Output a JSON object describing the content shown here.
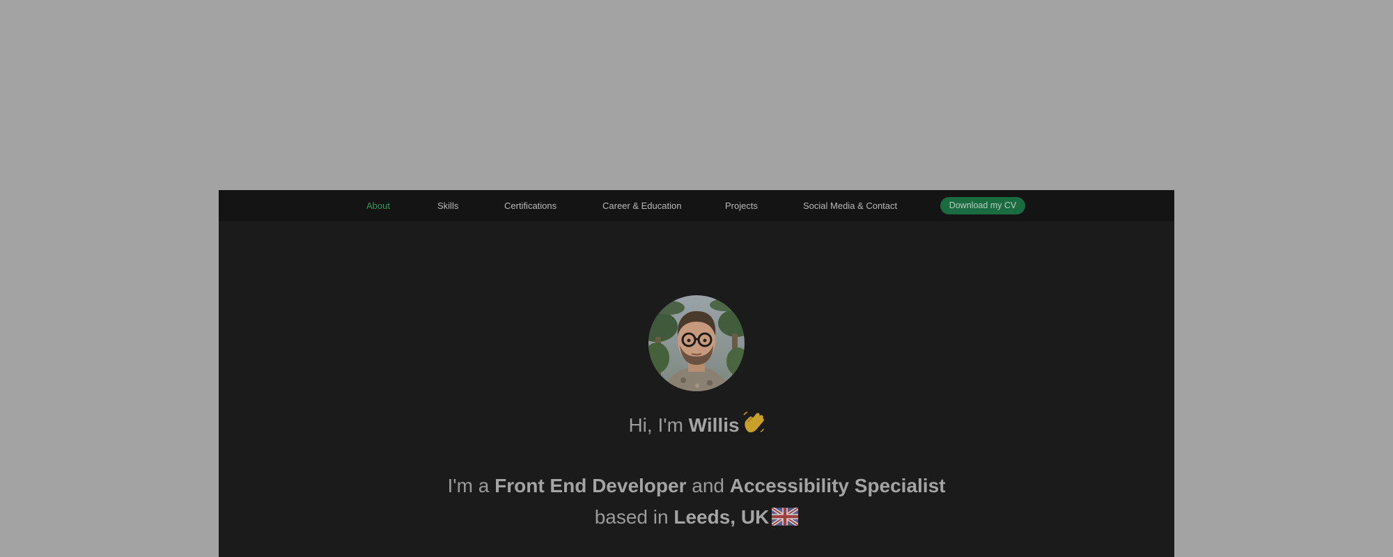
{
  "nav": {
    "items": [
      {
        "label": "About",
        "active": true
      },
      {
        "label": "Skills",
        "active": false
      },
      {
        "label": "Certifications",
        "active": false
      },
      {
        "label": "Career & Education",
        "active": false
      },
      {
        "label": "Projects",
        "active": false
      },
      {
        "label": "Social Media & Contact",
        "active": false
      }
    ],
    "cv_button": "Download my CV"
  },
  "hero": {
    "greeting_prefix": "Hi, I'm",
    "name": "Willis",
    "wave_emoji": "waving-hand",
    "intro": {
      "part1": "I'm a",
      "role1": "Front End Developer",
      "part2": "and",
      "role2": "Accessibility Specialist",
      "part3": "based in",
      "location": "Leeds, UK",
      "flag": "uk-flag"
    }
  },
  "colors": {
    "backdrop": "#a3a3a3",
    "page_bg": "#1b1b1b",
    "nav_bg": "#141414",
    "accent": "#2f9a59",
    "button_bg": "#1a6b40"
  }
}
